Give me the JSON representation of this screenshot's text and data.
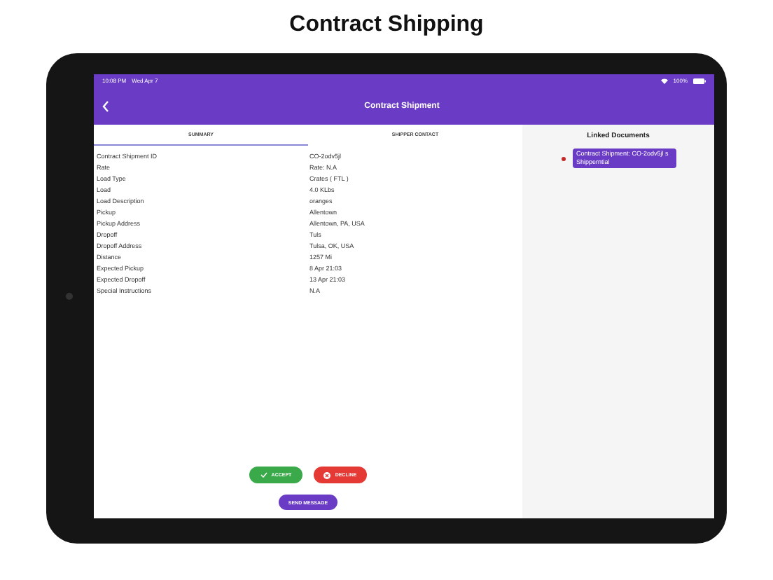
{
  "heading": "Contract Shipping",
  "status_bar": {
    "time": "10:08 PM",
    "date": "Wed Apr 7",
    "battery": "100%"
  },
  "nav": {
    "title": "Contract Shipment"
  },
  "tabs": [
    {
      "label": "SUMMARY",
      "selected": true
    },
    {
      "label": "SHIPPER CONTACT",
      "selected": false
    }
  ],
  "details": [
    {
      "label": "Contract Shipment ID",
      "value": "CO-2odv5jl"
    },
    {
      "label": "Rate",
      "value": "Rate: N.A"
    },
    {
      "label": "Load Type",
      "value": "Crates ( FTL )"
    },
    {
      "label": "Load",
      "value": "4.0 KLbs"
    },
    {
      "label": "Load Description",
      "value": "oranges"
    },
    {
      "label": "Pickup",
      "value": "Allentown"
    },
    {
      "label": "Pickup Address",
      "value": "Allentown, PA, USA"
    },
    {
      "label": "Dropoff",
      "value": "Tuls"
    },
    {
      "label": "Dropoff Address",
      "value": "Tulsa, OK, USA"
    },
    {
      "label": "Distance",
      "value": "1257 Mi"
    },
    {
      "label": "Expected Pickup",
      "value": "8 Apr 21:03"
    },
    {
      "label": "Expected Dropoff",
      "value": "13 Apr 21:03"
    },
    {
      "label": "Special Instructions",
      "value": "N.A"
    }
  ],
  "linked_documents": {
    "title": "Linked Documents",
    "items": [
      {
        "label": "Contract Shipment: CO-2odv5jl s Shipperntial",
        "color": "#c62828"
      }
    ]
  },
  "actions": [
    {
      "kind": "accept",
      "label": "ACCEPT"
    },
    {
      "kind": "decline",
      "label": "DECLINE"
    }
  ],
  "send_button": "SEND MESSAGE"
}
